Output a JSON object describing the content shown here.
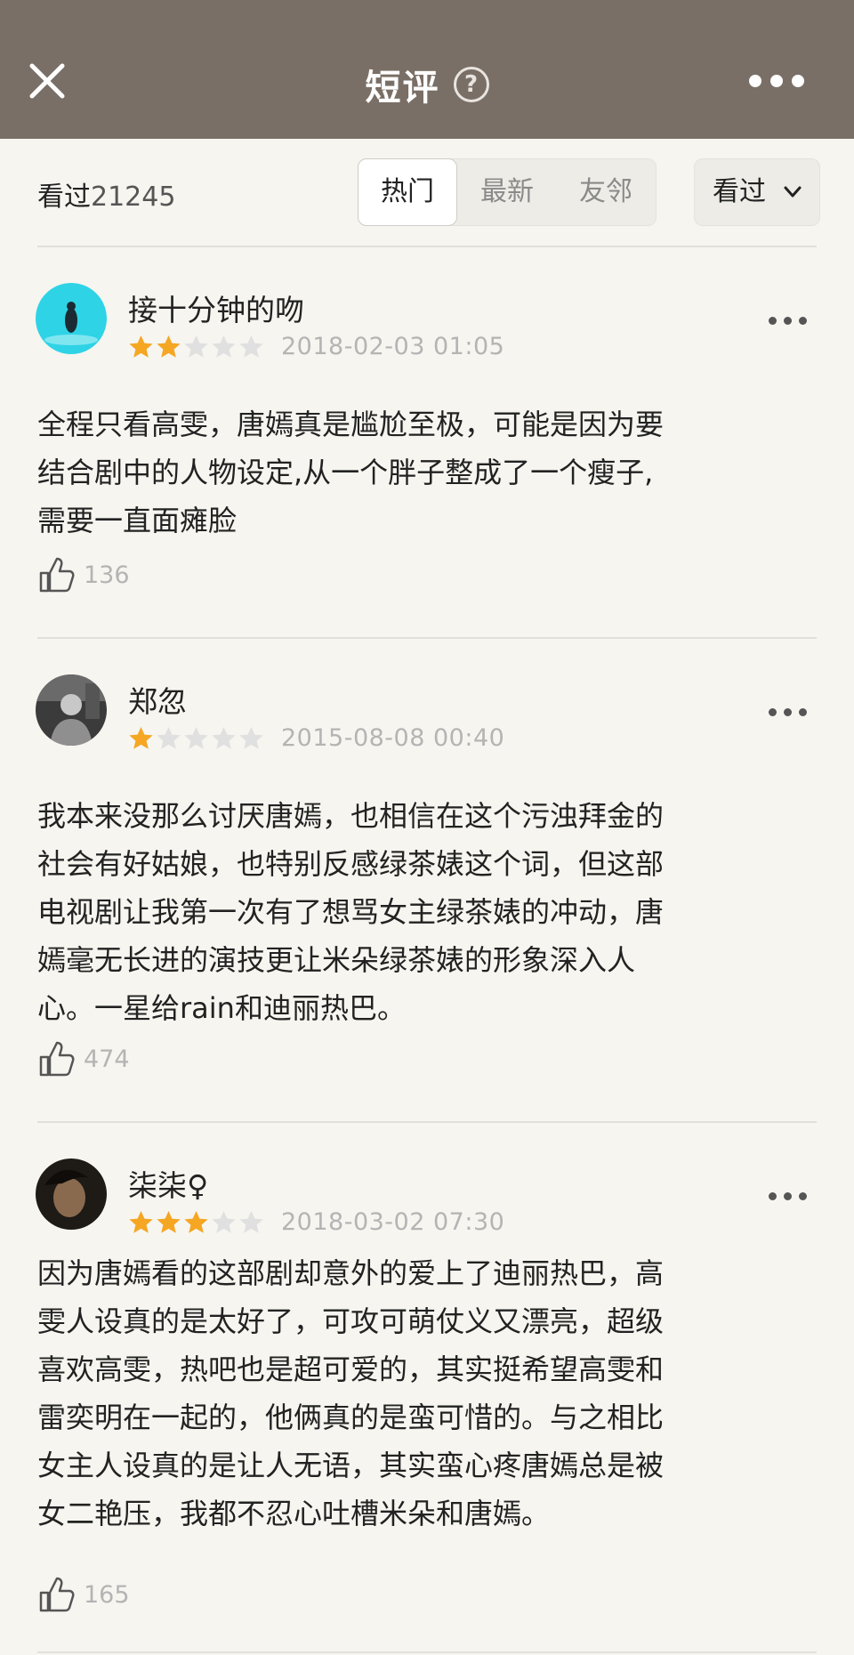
{
  "header": {
    "title": "短评",
    "help_icon": "?"
  },
  "filter": {
    "seen_label": "看过",
    "seen_count": "21245",
    "tabs": [
      "热门",
      "最新",
      "友邻"
    ],
    "active_tab": "热门",
    "seen_dropdown": "看过"
  },
  "reviews": [
    {
      "user": "接十分钟的吻",
      "rating": 2,
      "date": "2018-02-03 01:05",
      "text": "全程只看高雯，唐嫣真是尴尬至极，可能是因为要\n结合剧中的人物设定,从一个胖子整成了一个瘦子,\n需要一直面瘫脸",
      "likes": "136"
    },
    {
      "user": "郑忽",
      "rating": 1,
      "date": "2015-08-08 00:40",
      "text": "我本来没那么讨厌唐嫣，也相信在这个污浊拜金的\n社会有好姑娘，也特别反感绿茶婊这个词，但这部\n电视剧让我第一次有了想骂女主绿茶婊的冲动，唐\n嫣毫无长进的演技更让米朵绿茶婊的形象深入人\n心。一星给rain和迪丽热巴。",
      "likes": "474"
    },
    {
      "user": "柒柒♀",
      "rating": 3,
      "date": "2018-03-02 07:30",
      "text": "因为唐嫣看的这部剧却意外的爱上了迪丽热巴，高\n雯人设真的是太好了，可攻可萌仗义又漂亮，超级\n喜欢高雯，热吧也是超可爱的，其实挺希望高雯和\n雷奕明在一起的，他俩真的是蛮可惜的。与之相比\n女主人设真的是让人无语，其实蛮心疼唐嫣总是被\n女二艳压，我都不忍心吐槽米朵和唐嫣。",
      "likes": "165"
    }
  ],
  "colors": {
    "header_bg": "#7a6f66",
    "page_bg": "#f6f5f0",
    "star_on": "#f5a623",
    "star_off": "#e0e0e0"
  }
}
